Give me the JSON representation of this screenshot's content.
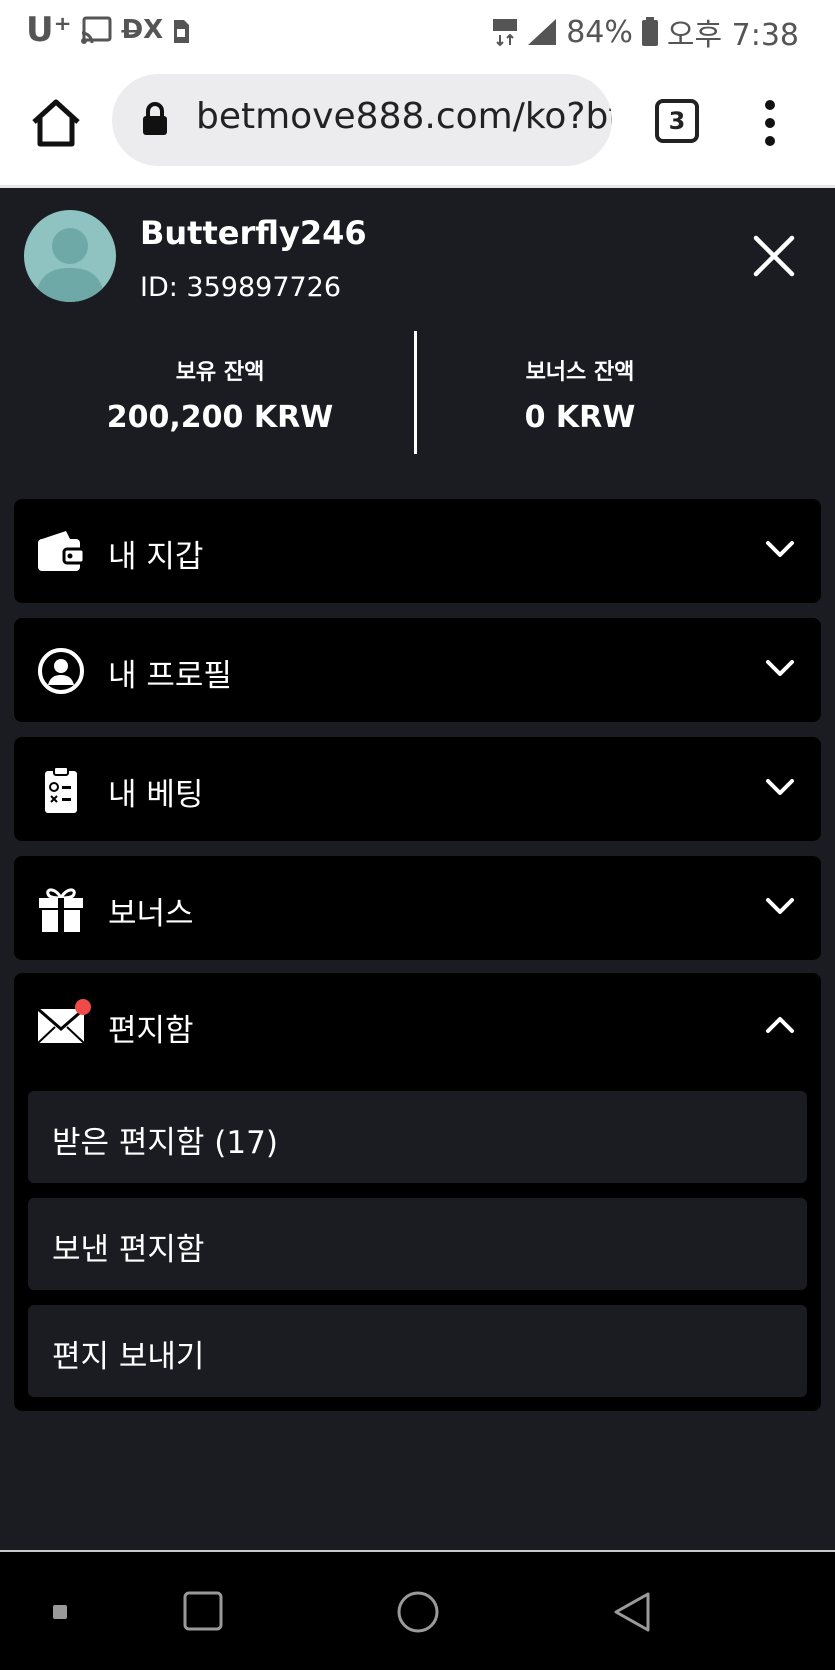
{
  "status_bar": {
    "carrier": "U⁺",
    "network": "D̶X",
    "battery_percent": "84%",
    "time": "오후 7:38",
    "icons": [
      "cast-icon",
      "sim-icon",
      "lte-icon",
      "signal-icon",
      "battery-icon"
    ]
  },
  "browser": {
    "url": "betmove888.com/ko?bt",
    "tab_count": "3"
  },
  "user": {
    "username": "Butterfly246",
    "id_label": "ID: 359897726"
  },
  "balances": {
    "held_label": "보유 잔액",
    "held_value": "200,200 KRW",
    "bonus_label": "보너스 잔액",
    "bonus_value": "0 KRW"
  },
  "menu": {
    "wallet": "내 지갑",
    "profile": "내 프로필",
    "betting": "내 베팅",
    "bonus": "보너스",
    "mailbox": "편지함"
  },
  "mailbox_items": {
    "inbox": "받은 편지함 (17)",
    "sent": "보낸 편지함",
    "compose": "편지 보내기"
  },
  "colors": {
    "panel_bg": "#1b1c21",
    "item_bg": "#000000",
    "notification_dot": "#f04b4b"
  }
}
